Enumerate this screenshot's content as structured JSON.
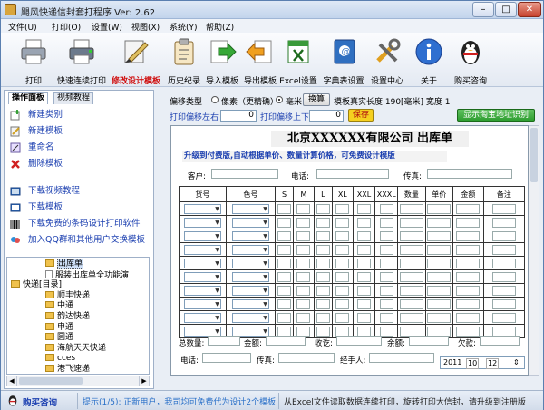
{
  "window": {
    "title": "飓风快递信封套打程序  Ver: 2.62",
    "min": "–",
    "max": "□",
    "close": "✕"
  },
  "menu": [
    "文件(U)",
    "打印(O)",
    "设置(W)",
    "视图(X)",
    "系统(Y)",
    "帮助(Z)"
  ],
  "toolbar": [
    {
      "label": "打印",
      "icon": "printer-icon",
      "highlight": false
    },
    {
      "label": "快速连续打印",
      "icon": "printer-continuous-icon",
      "highlight": false
    },
    {
      "label": "修改设计模板",
      "icon": "design-template-icon",
      "highlight": true
    },
    {
      "label": "历史纪录",
      "icon": "clipboard-history-icon",
      "highlight": false
    },
    {
      "label": "导入模板",
      "icon": "import-arrow-icon",
      "highlight": false
    },
    {
      "label": "导出模板",
      "icon": "export-arrow-icon",
      "highlight": false
    },
    {
      "label": "Excel设置",
      "icon": "excel-icon",
      "highlight": false
    },
    {
      "label": "字典表设置",
      "icon": "address-book-icon",
      "highlight": false
    },
    {
      "label": "设置中心",
      "icon": "tools-icon",
      "highlight": false
    },
    {
      "label": "关于",
      "icon": "info-icon",
      "highlight": false
    },
    {
      "label": "购买咨询",
      "icon": "qq-penguin-icon",
      "highlight": false
    }
  ],
  "left": {
    "tabs": [
      "操作面板",
      "视频教程"
    ],
    "actions": [
      {
        "label": "新建类别",
        "icon": "new-category-icon"
      },
      {
        "label": "新建模板",
        "icon": "new-template-icon"
      },
      {
        "label": "重命名",
        "icon": "rename-icon"
      },
      {
        "label": "删除模板",
        "icon": "delete-icon"
      }
    ],
    "links": [
      {
        "label": "下载视频教程",
        "icon": "video-icon"
      },
      {
        "label": "下载模板",
        "icon": "download-icon"
      },
      {
        "label": "下载免费的条码设计打印软件",
        "icon": "barcode-icon"
      },
      {
        "label": "加入QQ群和其他用户交换模板",
        "icon": "qq-group-icon"
      }
    ],
    "tree": [
      {
        "label": "出库单",
        "type": "folder",
        "level": 2,
        "selected": true
      },
      {
        "label": "服装出库单全功能演",
        "type": "doc",
        "level": 2
      },
      {
        "label": "快递[目录]",
        "type": "folder",
        "level": 1
      },
      {
        "label": "顺丰快递",
        "type": "folder",
        "level": 2
      },
      {
        "label": "中通",
        "type": "folder",
        "level": 2
      },
      {
        "label": "韵达快递",
        "type": "folder",
        "level": 2
      },
      {
        "label": "申通",
        "type": "folder",
        "level": 2
      },
      {
        "label": "圆通",
        "type": "folder",
        "level": 2
      },
      {
        "label": "海航天天快递",
        "type": "folder",
        "level": 2
      },
      {
        "label": "cces",
        "type": "folder",
        "level": 2
      },
      {
        "label": "港飞速递",
        "type": "folder",
        "level": 2
      }
    ]
  },
  "controls": {
    "offset_type": "偏移类型",
    "opt_pixel": "像素（更精确）",
    "opt_mm": "毫米",
    "convert_btn": "换算",
    "real_length": "模板真实长度 190[毫米] 宽度 1",
    "offset_lr_label": "打印偏移左右",
    "offset_lr": "0",
    "offset_ud_label": "打印偏移上下",
    "offset_ud": "0",
    "save_btn": "保存",
    "taobao_btn": "显示淘宝地址识别"
  },
  "form": {
    "title": "北京XXXXXX有限公司  出库单",
    "subtitle": "升级到付费版,自动根据单价、数量计算价格，可免费设计模版",
    "customer": "客户:",
    "phone": "电话:",
    "fax": "传真:",
    "columns": [
      "货号",
      "色号",
      "S",
      "M",
      "L",
      "XL",
      "XXL",
      "XXXL",
      "数量",
      "单价",
      "金额",
      "备注"
    ],
    "rows": 10,
    "total_qty": "总数量:",
    "amount": "金额:",
    "received": "收讫:",
    "balance": "余额:",
    "owed": "欠款:",
    "phone2": "电话:",
    "fax2": "传真:",
    "handler": "经手人:",
    "date": [
      "2011",
      "10",
      "12"
    ]
  },
  "status": {
    "buy": "购买咨询",
    "tip": "提示(1/5): 正新用户，我司均可免费代为设计2个模板",
    "excel_tip": "从Excel文件读取数据连续打印，旋转打印大信封，请升级到注册版"
  },
  "colors": {
    "accent_red": "#d01010",
    "link_blue": "#1b3fb0",
    "save_yellow": "#f5d020",
    "taobao_green": "#2e9e30"
  }
}
